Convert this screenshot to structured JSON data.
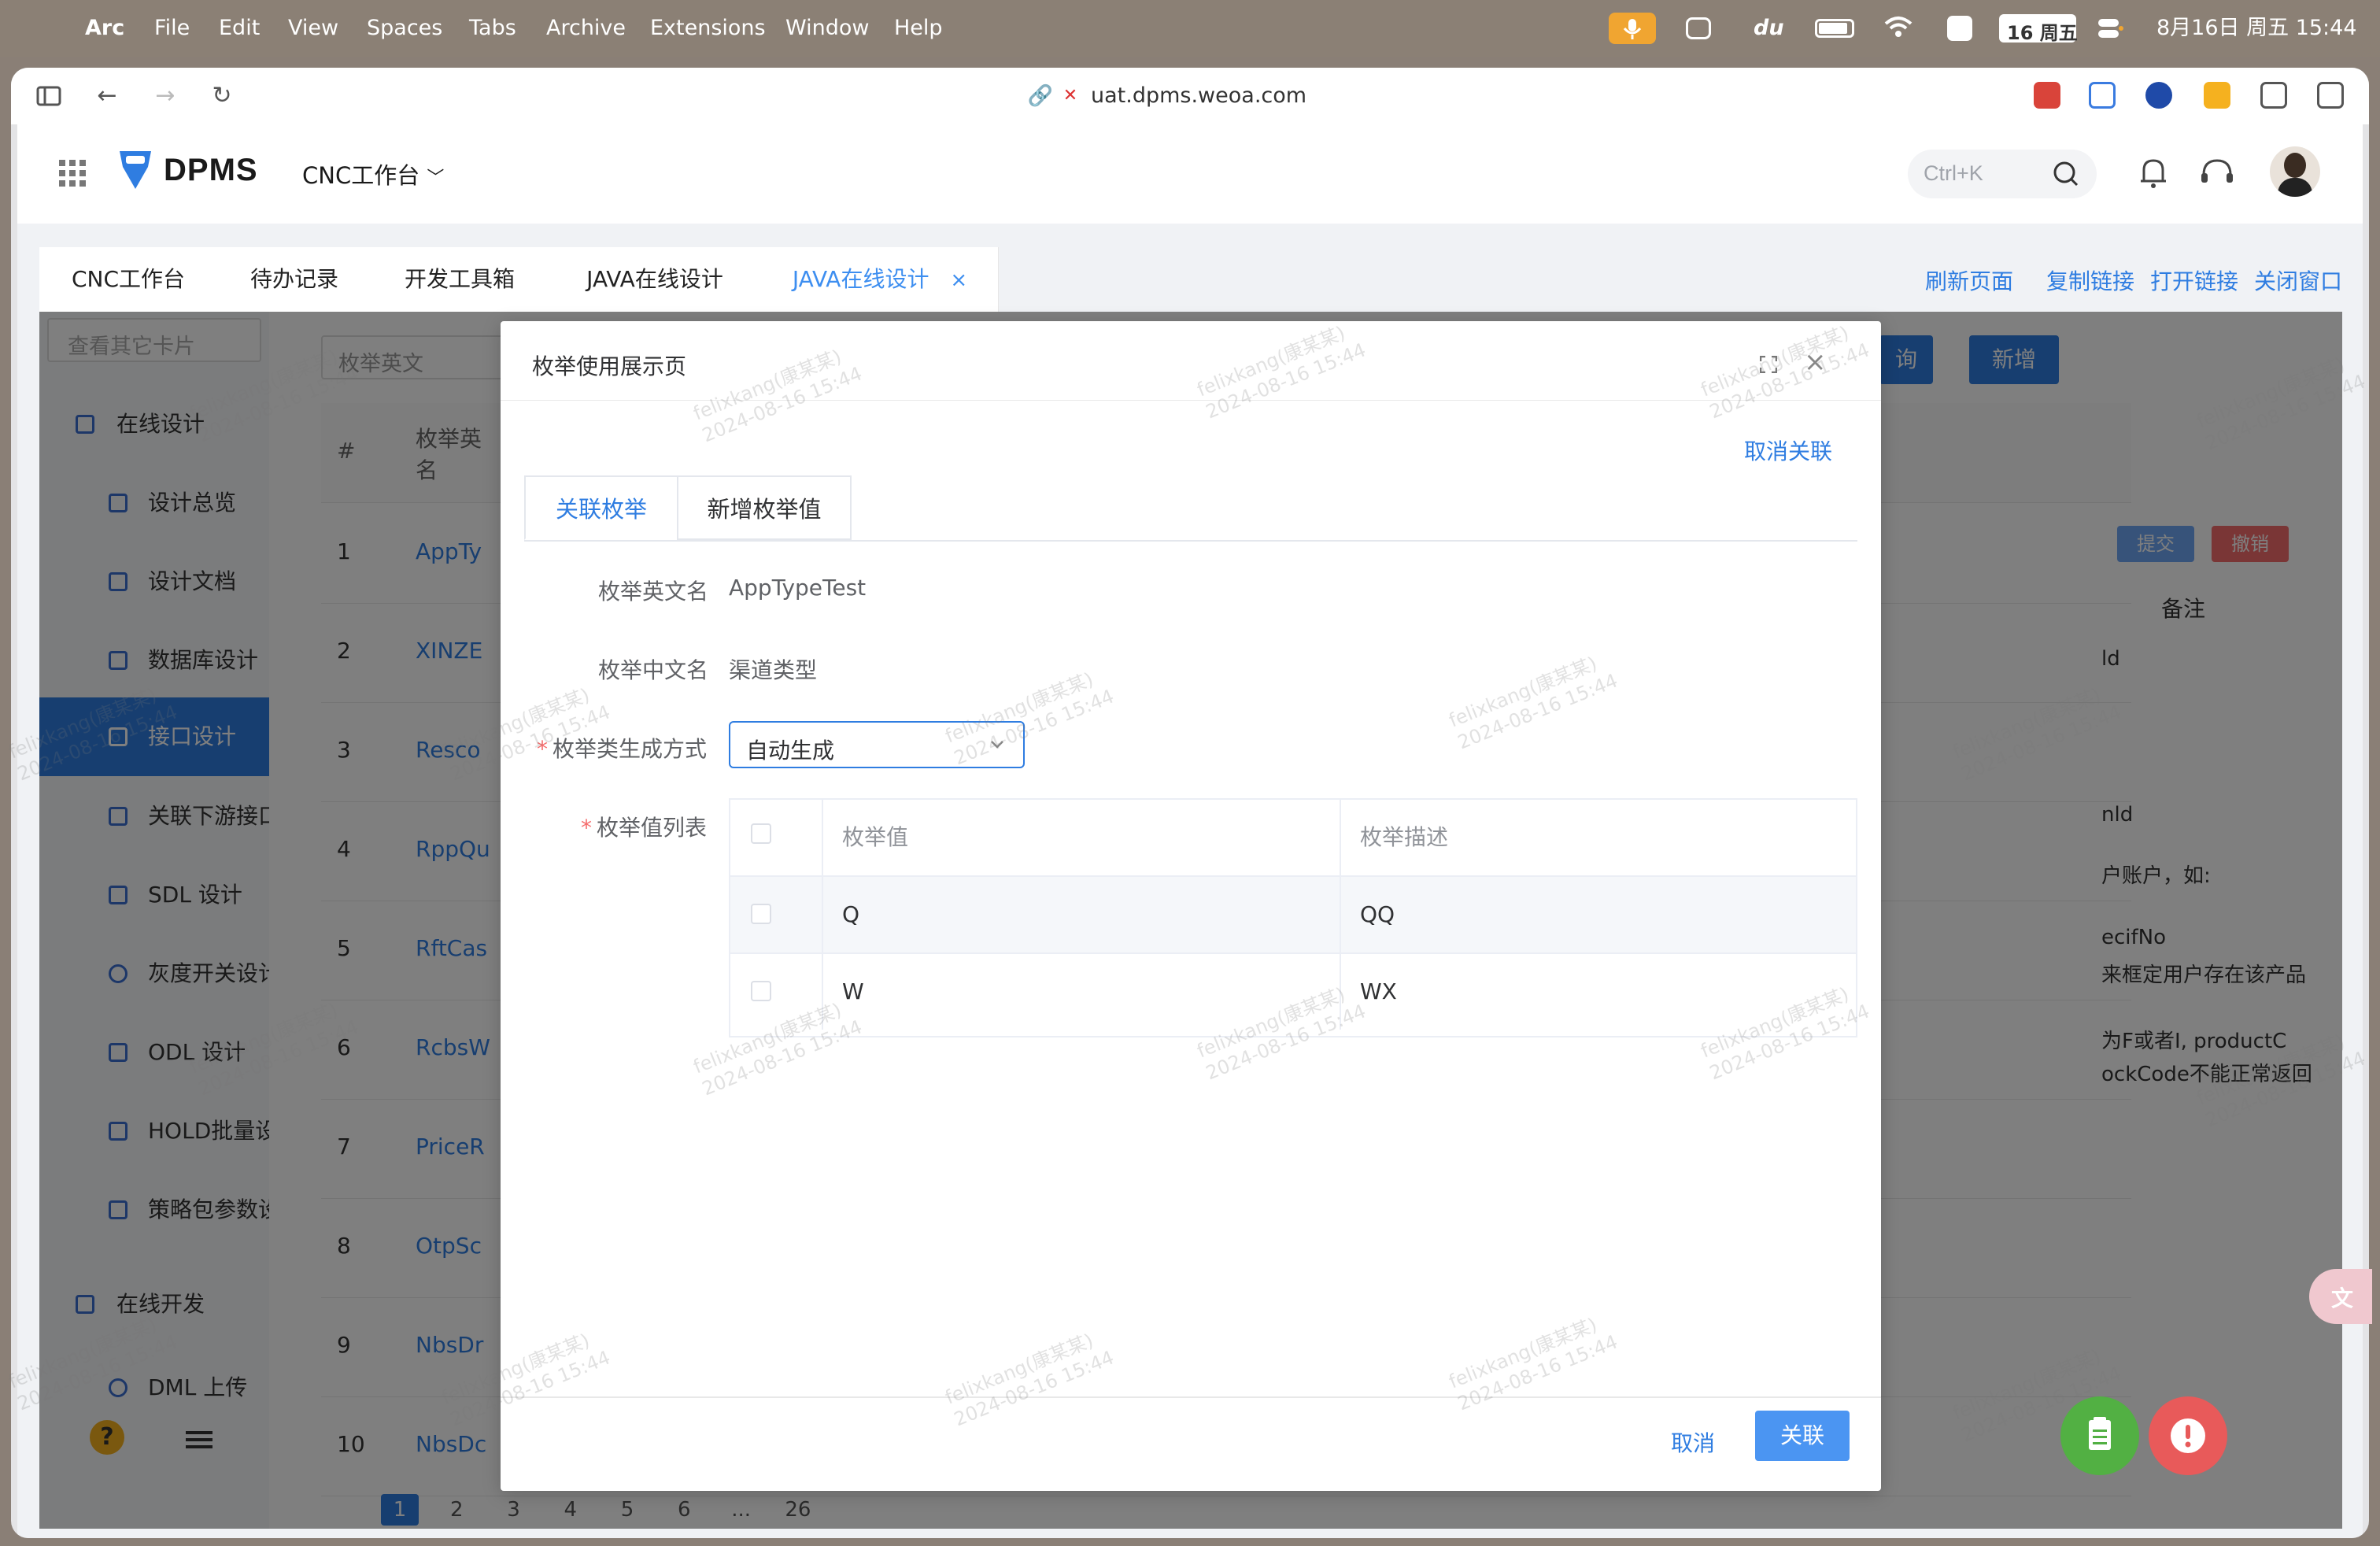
{
  "menubar": {
    "app": "Arc",
    "items": [
      "File",
      "Edit",
      "View",
      "Spaces",
      "Tabs",
      "Archive",
      "Extensions",
      "Window",
      "Help"
    ],
    "calendar_badge": "16 周五",
    "datetime": "8月16日 周五  15:44"
  },
  "browser": {
    "url": "uat.dpms.weoa.com"
  },
  "app": {
    "logo": "DPMS",
    "workspace": "CNC工作台",
    "search_placeholder": "Ctrl+K"
  },
  "page_tabs": [
    {
      "label": "CNC工作台"
    },
    {
      "label": "待办记录"
    },
    {
      "label": "开发工具箱"
    },
    {
      "label": "JAVA在线设计"
    },
    {
      "label": "JAVA在线设计"
    }
  ],
  "tab_actions": [
    "刷新页面",
    "复制链接",
    "打开链接",
    "关闭窗口"
  ],
  "background": {
    "card_search_placeholder": "查看其它卡片",
    "enum_search_placeholder": "枚举英文",
    "query_button": "询",
    "add_button": "新增",
    "submit_button": "提交",
    "revoke_button": "撤销",
    "table_header": [
      "#",
      "枚举英",
      "名"
    ],
    "remark_header": "备注",
    "sidebar": [
      {
        "label": "在线设计"
      },
      {
        "label": "设计总览"
      },
      {
        "label": "设计文档"
      },
      {
        "label": "数据库设计"
      },
      {
        "label": "接口设计"
      },
      {
        "label": "关联下游接口"
      },
      {
        "label": "SDL 设计"
      },
      {
        "label": "灰度开关设计"
      },
      {
        "label": "ODL 设计"
      },
      {
        "label": "HOLD批量设"
      },
      {
        "label": "策略包参数设"
      },
      {
        "label": "在线开发"
      },
      {
        "label": "DML 上传"
      }
    ],
    "rows": [
      {
        "num": "1",
        "name": "AppTy"
      },
      {
        "num": "2",
        "name": "XINZE"
      },
      {
        "num": "3",
        "name": "Resco"
      },
      {
        "num": "4",
        "name": "RppQu"
      },
      {
        "num": "5",
        "name": "RftCas"
      },
      {
        "num": "6",
        "name": "RcbsW"
      },
      {
        "num": "7",
        "name": "PriceR"
      },
      {
        "num": "8",
        "name": "OtpSc"
      },
      {
        "num": "9",
        "name": "NbsDr"
      },
      {
        "num": "10",
        "name": "NbsDc"
      }
    ],
    "right_texts": [
      "ld",
      "nld",
      "户账户，如:",
      "ecifNo",
      "来框定用户存在该产品",
      "为F或者I, productC",
      "ockCode不能正常返回"
    ],
    "pagination": [
      "1",
      "2",
      "3",
      "4",
      "5",
      "6",
      "...",
      "26"
    ]
  },
  "dialog": {
    "title": "枚举使用展示页",
    "unlink": "取消关联",
    "tabs": [
      {
        "label": "关联枚举"
      },
      {
        "label": "新增枚举值"
      }
    ],
    "fields": {
      "en_name_label": "枚举英文名",
      "en_name_value": "AppTypeTest",
      "cn_name_label": "枚举中文名",
      "cn_name_value": "渠道类型",
      "gen_label": "枚举类生成方式",
      "gen_value": "自动生成",
      "list_label": "枚举值列表"
    },
    "table": {
      "headers": [
        "枚举值",
        "枚举描述"
      ],
      "rows": [
        {
          "value": "Q",
          "desc": "QQ"
        },
        {
          "value": "W",
          "desc": "WX"
        }
      ]
    },
    "cancel": "取消",
    "confirm": "关联"
  },
  "watermark": {
    "user": "felixkang(康某某)",
    "time": "2024-08-16 15:44"
  },
  "colors": {
    "accent": "#2f7de1",
    "required": "#f56c6c",
    "fab_green": "#52b043",
    "fab_red": "#e85a5a"
  }
}
